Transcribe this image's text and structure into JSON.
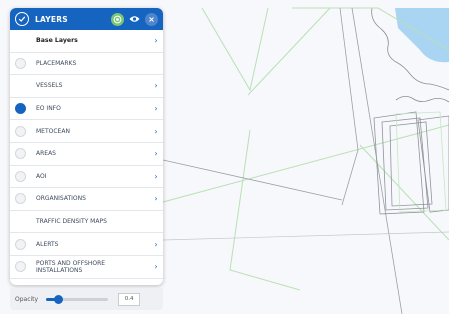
{
  "panel": {
    "title": "LAYERS",
    "colors": {
      "header": "#1565c0",
      "active": "#1565c0"
    },
    "icons": {
      "check": "check-circle-icon",
      "target": "target-icon",
      "eye": "eye-icon",
      "close": "close-icon"
    },
    "items": [
      {
        "label": "Base Layers",
        "selected": false,
        "has_radio": false,
        "chevron": true,
        "bold": true
      },
      {
        "label": "PLACEMARKS",
        "selected": false,
        "has_radio": true,
        "chevron": false,
        "bold": false
      },
      {
        "label": "VESSELS",
        "selected": false,
        "has_radio": false,
        "chevron": true,
        "bold": false
      },
      {
        "label": "EO INFO",
        "selected": true,
        "has_radio": true,
        "chevron": true,
        "bold": false
      },
      {
        "label": "METOCEAN",
        "selected": false,
        "has_radio": true,
        "chevron": true,
        "bold": false
      },
      {
        "label": "AREAS",
        "selected": false,
        "has_radio": true,
        "chevron": true,
        "bold": false
      },
      {
        "label": "AOI",
        "selected": false,
        "has_radio": true,
        "chevron": true,
        "bold": false
      },
      {
        "label": "ORGANISATIONS",
        "selected": false,
        "has_radio": true,
        "chevron": true,
        "bold": false
      },
      {
        "label": "TRAFFIC DENSITY MAPS",
        "selected": false,
        "has_radio": false,
        "chevron": false,
        "bold": false
      },
      {
        "label": "ALERTS",
        "selected": false,
        "has_radio": true,
        "chevron": true,
        "bold": false
      },
      {
        "label": "PORTS AND OFFSHORE INSTALLATIONS",
        "selected": false,
        "has_radio": true,
        "chevron": true,
        "bold": false
      }
    ]
  },
  "opacity": {
    "label": "Opacity",
    "value": 0.4,
    "value_text": "0.4"
  }
}
